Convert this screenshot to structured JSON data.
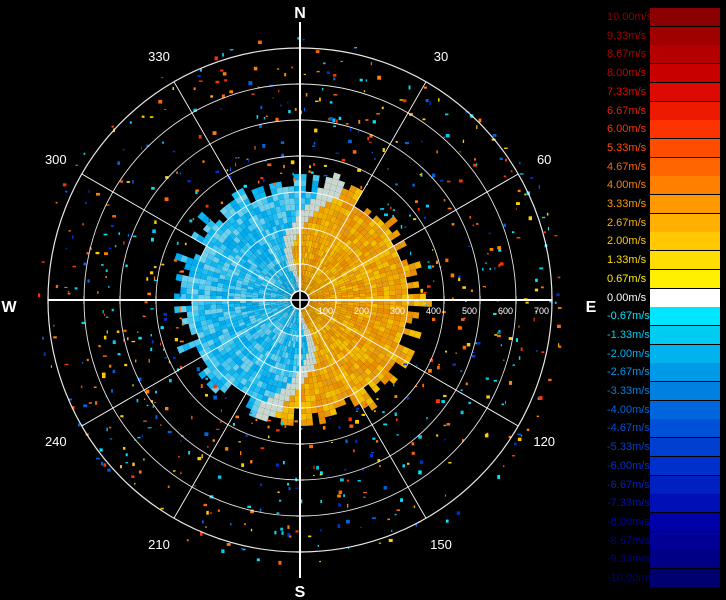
{
  "compass": {
    "north": "N",
    "south": "S",
    "east": "E",
    "west": "W"
  },
  "bearings": [
    {
      "deg": 30,
      "label": "30"
    },
    {
      "deg": 60,
      "label": "60"
    },
    {
      "deg": 120,
      "label": "120"
    },
    {
      "deg": 150,
      "label": "150"
    },
    {
      "deg": 210,
      "label": "210"
    },
    {
      "deg": 240,
      "label": "240"
    },
    {
      "deg": 300,
      "label": "300"
    },
    {
      "deg": 330,
      "label": "330"
    }
  ],
  "range_labels": [
    "100",
    "200",
    "300",
    "400",
    "500",
    "600",
    "700"
  ],
  "legend": [
    {
      "label": "10.00m/s",
      "color": "#8b0000"
    },
    {
      "label": "9.33m/s",
      "color": "#a00000"
    },
    {
      "label": "8.67m/s",
      "color": "#b40000"
    },
    {
      "label": "8.00m/s",
      "color": "#c80000"
    },
    {
      "label": "7.33m/s",
      "color": "#dc0a00"
    },
    {
      "label": "6.67m/s",
      "color": "#ee1a00"
    },
    {
      "label": "6.00m/s",
      "color": "#ff3300"
    },
    {
      "label": "5.33m/s",
      "color": "#ff4d00"
    },
    {
      "label": "4.67m/s",
      "color": "#ff6600"
    },
    {
      "label": "4.00m/s",
      "color": "#ff8000"
    },
    {
      "label": "3.33m/s",
      "color": "#ff9900"
    },
    {
      "label": "2.67m/s",
      "color": "#ffb000"
    },
    {
      "label": "2.00m/s",
      "color": "#ffc800"
    },
    {
      "label": "1.33m/s",
      "color": "#ffdd00"
    },
    {
      "label": "0.67m/s",
      "color": "#fff000"
    },
    {
      "label": "0.00m/s",
      "color": "#ffffff"
    },
    {
      "label": "-0.67m/s",
      "color": "#00e6ff"
    },
    {
      "label": "-1.33m/s",
      "color": "#00ccf2"
    },
    {
      "label": "-2.00m/s",
      "color": "#00b3ee"
    },
    {
      "label": "-2.67m/s",
      "color": "#0099e8"
    },
    {
      "label": "-3.33m/s",
      "color": "#0080e0"
    },
    {
      "label": "-4.00m/s",
      "color": "#0066dd"
    },
    {
      "label": "-4.67m/s",
      "color": "#0050d8"
    },
    {
      "label": "-5.33m/s",
      "color": "#0040d0"
    },
    {
      "label": "-6.00m/s",
      "color": "#0030cc"
    },
    {
      "label": "-6.67m/s",
      "color": "#0020c0"
    },
    {
      "label": "-7.33m/s",
      "color": "#0010b4"
    },
    {
      "label": "-8.00m/s",
      "color": "#0000a8"
    },
    {
      "label": "-8.67m/s",
      "color": "#000096"
    },
    {
      "label": "-9.33m/s",
      "color": "#000084"
    },
    {
      "label": "-10.00m/s",
      "color": "#000070"
    }
  ],
  "colors": {
    "background": "#000000",
    "grid": "#ffffff",
    "approach": "#00aaff",
    "recede": "#ffb000"
  }
}
